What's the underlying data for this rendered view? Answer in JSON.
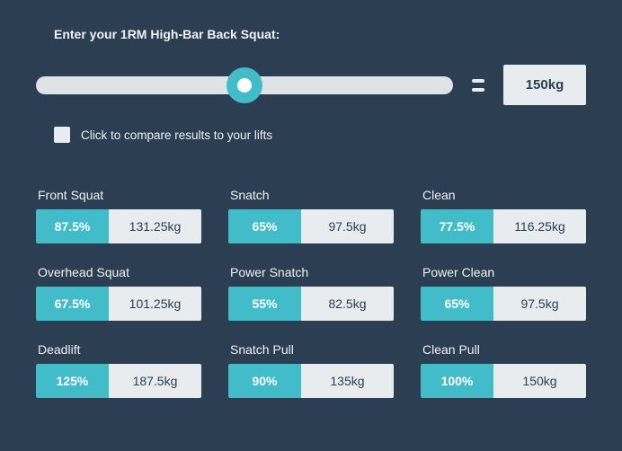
{
  "prompt": "Enter your 1RM High-Bar Back Squat:",
  "input_value": "150kg",
  "compare_label": "Click to compare results to your lifts",
  "lifts": [
    {
      "name": "Front Squat",
      "pct": "87.5%",
      "wt": "131.25kg"
    },
    {
      "name": "Snatch",
      "pct": "65%",
      "wt": "97.5kg"
    },
    {
      "name": "Clean",
      "pct": "77.5%",
      "wt": "116.25kg"
    },
    {
      "name": "Overhead Squat",
      "pct": "67.5%",
      "wt": "101.25kg"
    },
    {
      "name": "Power Snatch",
      "pct": "55%",
      "wt": "82.5kg"
    },
    {
      "name": "Power Clean",
      "pct": "65%",
      "wt": "97.5kg"
    },
    {
      "name": "Deadlift",
      "pct": "125%",
      "wt": "187.5kg"
    },
    {
      "name": "Snatch Pull",
      "pct": "90%",
      "wt": "135kg"
    },
    {
      "name": "Clean Pull",
      "pct": "100%",
      "wt": "150kg"
    }
  ]
}
